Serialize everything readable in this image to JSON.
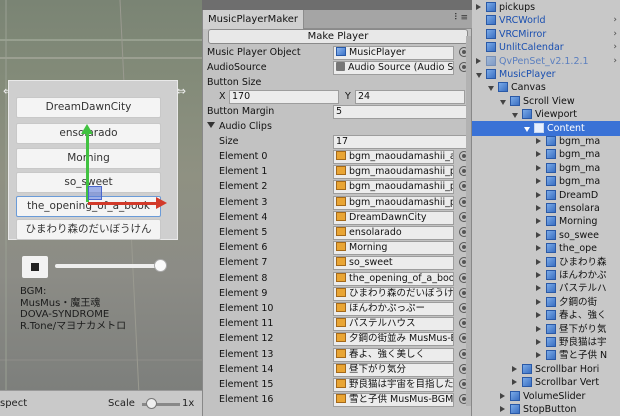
{
  "scene": {
    "buttons": [
      {
        "label": "DreamDawnCity"
      },
      {
        "label": "ensolarado"
      },
      {
        "label": "Morning"
      },
      {
        "label": "so_sweet"
      },
      {
        "label": "the_opening_of_a_book"
      },
      {
        "label": "ひまわり森のだいぼうけん"
      }
    ],
    "volume_level": 0.95,
    "credits": [
      "BGM:",
      "MusMus・魔王魂",
      "DOVA-SYNDROME",
      "R.Tone/マヨナカメトロ"
    ],
    "toolbar": {
      "aspect_label": "spect",
      "scale_label": "Scale",
      "scale_value": "1x"
    }
  },
  "inspector": {
    "tab_title": "MusicPlayerMaker",
    "make_button": "Make Player",
    "music_player_object": {
      "label": "Music Player Object",
      "value": "MusicPlayer",
      "icon": "cube-icon"
    },
    "audio_source": {
      "label": "AudioSource",
      "value": "Audio Source (Audio S",
      "icon": "audio-source-icon"
    },
    "button_size": {
      "label": "Button Size",
      "x_label": "X",
      "x": "170",
      "y_label": "Y",
      "y": "24"
    },
    "button_margin": {
      "label": "Button Margin",
      "value": "5"
    },
    "audio_clips": {
      "label": "Audio Clips",
      "size_label": "Size",
      "size": "17",
      "elements": [
        {
          "label": "Element 0",
          "value": "bgm_maoudamashii_a"
        },
        {
          "label": "Element 1",
          "value": "bgm_maoudamashii_p"
        },
        {
          "label": "Element 2",
          "value": "bgm_maoudamashii_p"
        },
        {
          "label": "Element 3",
          "value": "bgm_maoudamashii_p"
        },
        {
          "label": "Element 4",
          "value": "DreamDawnCity"
        },
        {
          "label": "Element 5",
          "value": "ensolarado"
        },
        {
          "label": "Element 6",
          "value": "Morning"
        },
        {
          "label": "Element 7",
          "value": "so_sweet"
        },
        {
          "label": "Element 8",
          "value": "the_opening_of_a_boo"
        },
        {
          "label": "Element 9",
          "value": "ひまわり森のだいぼうけん"
        },
        {
          "label": "Element 10",
          "value": "ほんわかぷっぷー"
        },
        {
          "label": "Element 11",
          "value": "パステルハウス"
        },
        {
          "label": "Element 12",
          "value": "夕鋼の街並み MusMus-Bo"
        },
        {
          "label": "Element 13",
          "value": "春よ、強く美しく"
        },
        {
          "label": "Element 14",
          "value": "昼下がり気分"
        },
        {
          "label": "Element 15",
          "value": "野良猫は宇宙を目指した"
        },
        {
          "label": "Element 16",
          "value": "雪と子供 MusMus-BGM-"
        }
      ]
    }
  },
  "hierarchy": {
    "rows": [
      {
        "text": "pickups",
        "indent": 0,
        "arrow": "right",
        "style": "normal"
      },
      {
        "text": "VRCWorld",
        "indent": 0,
        "arrow": "none",
        "style": "blue",
        "chev": true
      },
      {
        "text": "VRCMirror",
        "indent": 0,
        "arrow": "none",
        "style": "blue",
        "chev": true
      },
      {
        "text": "UnlitCalendar",
        "indent": 0,
        "arrow": "none",
        "style": "blue",
        "chev": true
      },
      {
        "text": "QvPenSet_v2.1.2.1",
        "indent": 0,
        "arrow": "right",
        "style": "faded",
        "chev": true
      },
      {
        "text": "MusicPlayer",
        "indent": 0,
        "arrow": "down",
        "style": "blue"
      },
      {
        "text": "Canvas",
        "indent": 1,
        "arrow": "down",
        "style": "normal"
      },
      {
        "text": "Scroll View",
        "indent": 2,
        "arrow": "down",
        "style": "normal"
      },
      {
        "text": "Viewport",
        "indent": 3,
        "arrow": "down",
        "style": "normal"
      },
      {
        "text": "Content",
        "indent": 4,
        "arrow": "down",
        "style": "selected"
      },
      {
        "text": "bgm_ma",
        "indent": 5,
        "arrow": "right",
        "style": "normal"
      },
      {
        "text": "bgm_ma",
        "indent": 5,
        "arrow": "right",
        "style": "normal"
      },
      {
        "text": "bgm_ma",
        "indent": 5,
        "arrow": "right",
        "style": "normal"
      },
      {
        "text": "bgm_ma",
        "indent": 5,
        "arrow": "right",
        "style": "normal"
      },
      {
        "text": "DreamD",
        "indent": 5,
        "arrow": "right",
        "style": "normal"
      },
      {
        "text": "ensolara",
        "indent": 5,
        "arrow": "right",
        "style": "normal"
      },
      {
        "text": "Morning",
        "indent": 5,
        "arrow": "right",
        "style": "normal"
      },
      {
        "text": "so_swee",
        "indent": 5,
        "arrow": "right",
        "style": "normal"
      },
      {
        "text": "the_ope",
        "indent": 5,
        "arrow": "right",
        "style": "normal"
      },
      {
        "text": "ひまわり森",
        "indent": 5,
        "arrow": "right",
        "style": "normal"
      },
      {
        "text": "ほんわかぷ",
        "indent": 5,
        "arrow": "right",
        "style": "normal"
      },
      {
        "text": "パステルハ",
        "indent": 5,
        "arrow": "right",
        "style": "normal"
      },
      {
        "text": "夕鋼の街",
        "indent": 5,
        "arrow": "right",
        "style": "normal"
      },
      {
        "text": "春よ、強く",
        "indent": 5,
        "arrow": "right",
        "style": "normal"
      },
      {
        "text": "昼下がり気",
        "indent": 5,
        "arrow": "right",
        "style": "normal"
      },
      {
        "text": "野良猫は宇",
        "indent": 5,
        "arrow": "right",
        "style": "normal"
      },
      {
        "text": "雪と子供 N",
        "indent": 5,
        "arrow": "right",
        "style": "normal"
      },
      {
        "text": "Scrollbar Hori",
        "indent": 3,
        "arrow": "right",
        "style": "normal"
      },
      {
        "text": "Scrollbar Vert",
        "indent": 3,
        "arrow": "right",
        "style": "normal"
      },
      {
        "text": "VolumeSlider",
        "indent": 2,
        "arrow": "right",
        "style": "normal"
      },
      {
        "text": "StopButton",
        "indent": 2,
        "arrow": "right",
        "style": "normal"
      }
    ]
  }
}
